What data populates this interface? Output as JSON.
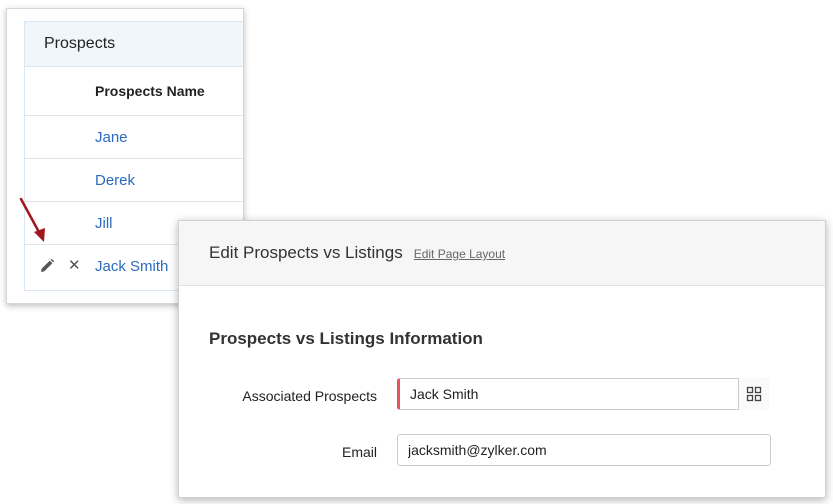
{
  "prospects_panel": {
    "title": "Prospects",
    "column_header": "Prospects Name",
    "rows": [
      {
        "name": "Jane"
      },
      {
        "name": "Derek"
      },
      {
        "name": "Jill"
      },
      {
        "name": "Jack Smith"
      }
    ],
    "row_actions": {
      "edit_icon": "pencil-icon",
      "delete_icon": "close-icon",
      "delete_glyph": "✕"
    }
  },
  "edit_panel": {
    "title": "Edit Prospects vs Listings",
    "layout_link": "Edit Page Layout",
    "section_title": "Prospects vs Listings Information",
    "fields": {
      "associated_prospects": {
        "label": "Associated Prospects",
        "value": "Jack Smith",
        "lookup_icon": "lookup-icon"
      },
      "email": {
        "label": "Email",
        "value": "jacksmith@zylker.com"
      }
    }
  },
  "colors": {
    "link": "#2a6bc0",
    "required_marker": "#e8525b",
    "annotation_arrow": "#a3141c"
  }
}
